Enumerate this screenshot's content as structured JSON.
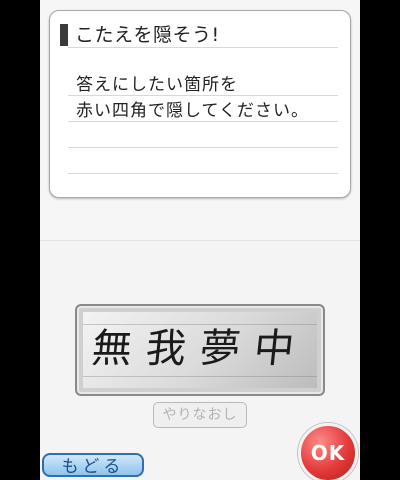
{
  "dialog": {
    "title": "こたえを隠そう!",
    "message_lines": [
      "答えにしたい箇所を",
      "赤い四角で隠してください。"
    ]
  },
  "canvas": {
    "handwritten_text": "無我夢中"
  },
  "buttons": {
    "redo_label": "やりなおし",
    "back_label": "もどる",
    "ok_label": "OK"
  },
  "colors": {
    "ok_button": "#e33a3a",
    "back_button": "#8fc3ec",
    "panel_background": "#ffffff",
    "screen_background": "#f4f4f4"
  }
}
